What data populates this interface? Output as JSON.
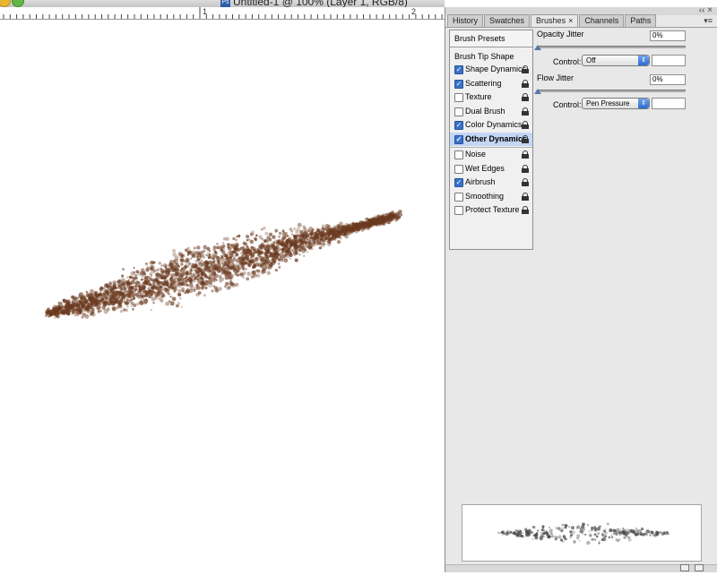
{
  "window": {
    "title": "Untitled-1 @ 100% (Layer 1, RGB/8)",
    "app_badge": "Ps"
  },
  "ruler": {
    "marks": [
      "1",
      "2"
    ]
  },
  "panel": {
    "tabs": [
      {
        "label": "History",
        "active": false
      },
      {
        "label": "Swatches",
        "active": false
      },
      {
        "label": "Brushes",
        "active": true
      },
      {
        "label": "Channels",
        "active": false
      },
      {
        "label": "Paths",
        "active": false
      }
    ],
    "sidebar": {
      "header": "Brush Presets",
      "tip_shape": "Brush Tip Shape",
      "items": [
        {
          "label": "Shape Dynamics",
          "checked": true,
          "selected": false,
          "sep": false
        },
        {
          "label": "Scattering",
          "checked": true,
          "selected": false,
          "sep": false
        },
        {
          "label": "Texture",
          "checked": false,
          "selected": false,
          "sep": false
        },
        {
          "label": "Dual Brush",
          "checked": false,
          "selected": false,
          "sep": false
        },
        {
          "label": "Color Dynamics",
          "checked": true,
          "selected": false,
          "sep": false
        },
        {
          "label": "Other Dynamics",
          "checked": true,
          "selected": true,
          "sep": false
        },
        {
          "label": "Noise",
          "checked": false,
          "selected": false,
          "sep": true
        },
        {
          "label": "Wet Edges",
          "checked": false,
          "selected": false,
          "sep": false
        },
        {
          "label": "Airbrush",
          "checked": true,
          "selected": false,
          "sep": false
        },
        {
          "label": "Smoothing",
          "checked": false,
          "selected": false,
          "sep": false
        },
        {
          "label": "Protect Texture",
          "checked": false,
          "selected": false,
          "sep": false
        }
      ]
    },
    "options": {
      "opacity_jitter": {
        "label": "Opacity Jitter",
        "value": "0%",
        "control_label": "Control:",
        "control_value": "Off"
      },
      "flow_jitter": {
        "label": "Flow Jitter",
        "value": "0%",
        "control_label": "Control:",
        "control_value": "Pen Pressure"
      }
    }
  },
  "colors": {
    "brush_stroke": "#6b3a1f",
    "selection": "#c4d6f5",
    "checkbox_on": "#3a72c8"
  }
}
